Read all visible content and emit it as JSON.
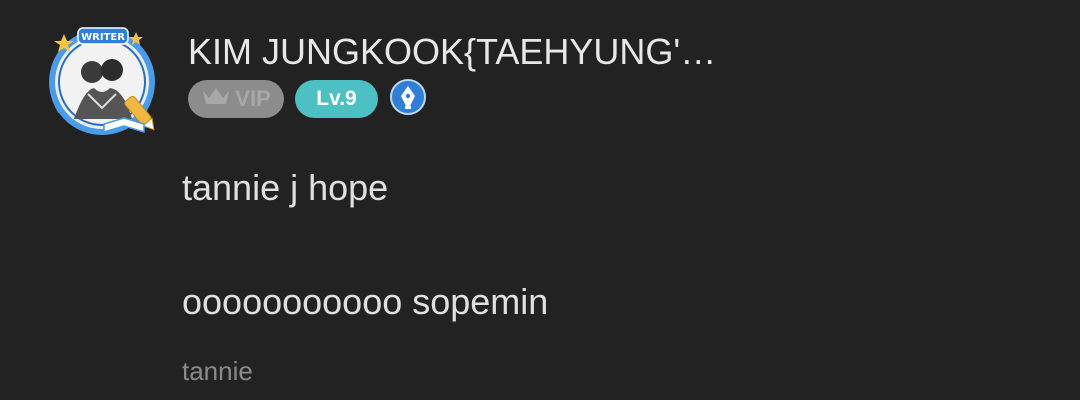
{
  "profile": {
    "avatar_badge_text": "WRITER",
    "avatar_icon": "avatar-portrait",
    "username": "KIM JUNGKOOK{TAEHYUNG'…",
    "badges": {
      "vip_label": "VIP",
      "vip_icon": "crown-icon",
      "level_label": "Lv.9",
      "writer_icon": "pen-nib-icon"
    }
  },
  "post": {
    "lines": [
      "tannie j hope",
      "ooooooooooo sopemin"
    ],
    "caption": "tannie"
  },
  "colors": {
    "background": "#222222",
    "vip_badge": "#8c8c8c",
    "level_badge": "#4cc0c3",
    "writer_badge": "#2f7fd6",
    "avatar_ring": "#4a9be8"
  }
}
